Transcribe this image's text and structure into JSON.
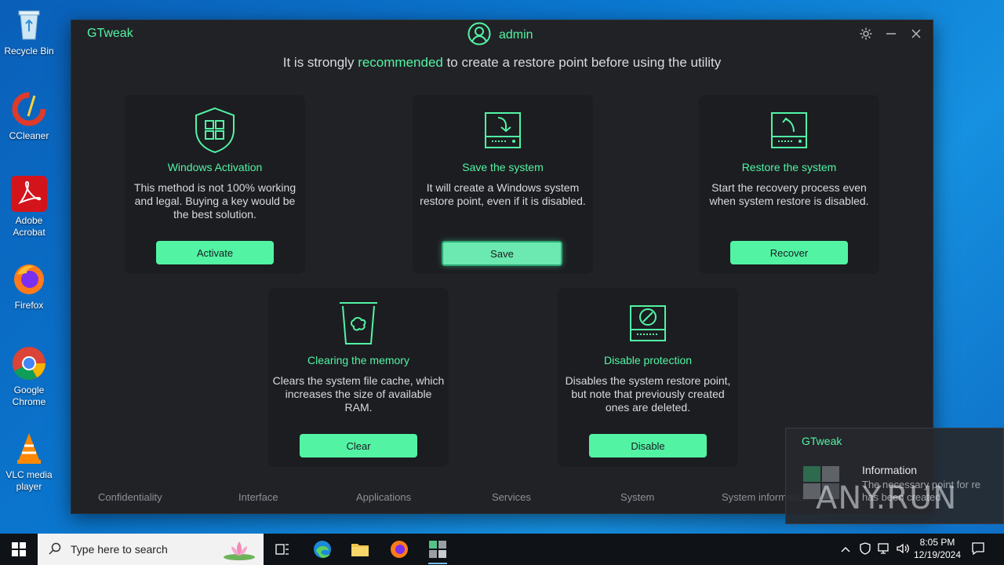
{
  "desktop": {
    "icons": [
      {
        "label": "Recycle Bin"
      },
      {
        "label": "CCleaner"
      },
      {
        "label": "Adobe Acrobat"
      },
      {
        "label": "Firefox"
      },
      {
        "label": "Google Chrome"
      },
      {
        "label": "VLC media player"
      }
    ]
  },
  "window": {
    "app_title": "GTweak",
    "user": "admin",
    "banner_prefix": "It is strongly ",
    "banner_highlight": "recommended",
    "banner_suffix": " to create a restore point before using the utility",
    "accent_color": "#52f4a4",
    "cards": [
      {
        "title": "Windows Activation",
        "desc": "This method is not 100% working and legal. Buying a key would be the best solution.",
        "button": "Activate",
        "icon": "shield-windows-icon"
      },
      {
        "title": "Save the system",
        "desc": "It will create a Windows system restore point, even if it is disabled.",
        "button": "Save",
        "icon": "drive-save-icon"
      },
      {
        "title": "Restore the system",
        "desc": "Start the recovery process even when system restore is disabled.",
        "button": "Recover",
        "icon": "drive-restore-icon"
      },
      {
        "title": "Clearing the memory",
        "desc": "Clears the system file cache, which increases the size of available RAM.",
        "button": "Clear",
        "icon": "trash-icon"
      },
      {
        "title": "Disable protection",
        "desc": "Disables the system restore point, but note that previously created ones are deleted.",
        "button": "Disable",
        "icon": "drive-disable-icon"
      }
    ],
    "nav": [
      "Confidentiality",
      "Interface",
      "Applications",
      "Services",
      "System",
      "System information"
    ]
  },
  "notification": {
    "app": "GTweak",
    "title": "Information",
    "body_line1": "The necessary point for re",
    "body_line2": "has been created"
  },
  "watermark": "ANY.RUN",
  "taskbar": {
    "search_placeholder": "Type here to search",
    "time": "8:05 PM",
    "date": "12/19/2024"
  }
}
